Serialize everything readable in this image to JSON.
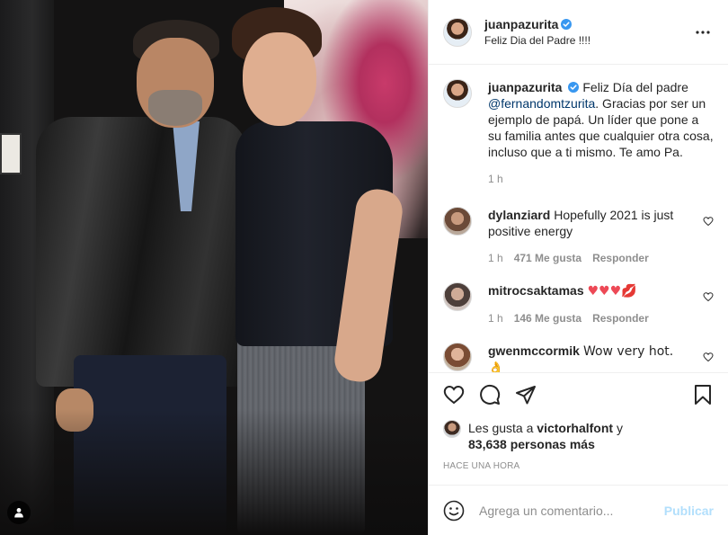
{
  "post": {
    "author": "juanpazurita",
    "verified": true,
    "location": "Feliz Dia del Padre !!!!",
    "photo_alt": "",
    "caption": {
      "username": "juanpazurita",
      "text_before": "Feliz Día del padre ",
      "mention": "@fernandomtzurita",
      "text_after": ". Gracias por ser un ejemplo de papá. Un líder que pone a su familia antes que cualquier otra cosa, incluso que a ti mismo. Te amo Pa.",
      "time": "1 h"
    },
    "comments": [
      {
        "username": "dylanziard",
        "text": "Hopefully 2021 is just positive energy",
        "time": "1 h",
        "likes": "471 Me gusta",
        "reply_label": "Responder"
      },
      {
        "username": "mitrocsaktamas",
        "text": "♥♥♥💋",
        "time": "1 h",
        "likes": "146 Me gusta",
        "reply_label": "Responder"
      },
      {
        "username": "gwenmccormik",
        "text": "Wow very hot. 👌",
        "time": "",
        "likes": "",
        "reply_label": ""
      }
    ],
    "liked_by_prefix": "Les gusta a ",
    "liked_by_user": "victorhalfont",
    "liked_by_joiner": " y",
    "liked_by_others": "83,638 personas más",
    "timestamp": "HACE UNA HORA",
    "comment_placeholder": "Agrega un comentario...",
    "publish_label": "Publicar"
  },
  "icons": {
    "verified": "verified-badge-icon",
    "more": "more-options-icon",
    "like": "heart-icon",
    "comment": "comment-icon",
    "share": "paper-plane-icon",
    "save": "bookmark-icon",
    "emoji": "emoji-smiley-icon",
    "tag": "user-tag-icon"
  },
  "colors": {
    "verified_blue": "#3897f0",
    "link_blue": "#00376b",
    "publish_disabled": "#b2dffc",
    "secondary_text": "#8e8e8e",
    "heart_red": "#ed4956"
  }
}
